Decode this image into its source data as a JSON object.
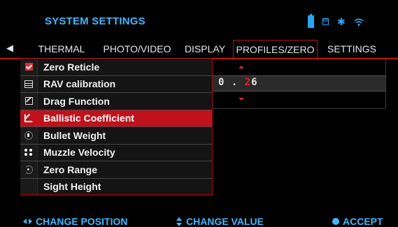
{
  "header": {
    "title": "SYSTEM SETTINGS",
    "status_icons": [
      "battery-icon",
      "sd-card-icon",
      "bluetooth-icon",
      "wifi-icon"
    ],
    "sd_label": "SD",
    "bt_glyph": "✱"
  },
  "nav": {
    "back_icon": "back-arrow-icon",
    "back_glyph": "◀",
    "tabs": [
      {
        "label": "THERMAL",
        "active": false
      },
      {
        "label": "PHOTO/VIDEO",
        "active": false
      },
      {
        "label": "DISPLAY",
        "active": false
      },
      {
        "label": "PROFILES/ZERO",
        "active": true
      },
      {
        "label": "SETTINGS",
        "active": false
      }
    ]
  },
  "menu": {
    "items": [
      {
        "label": "Zero Reticle",
        "icon": "checkbox-icon",
        "selected": false
      },
      {
        "label": "RAV calibration",
        "icon": "calculator-icon",
        "selected": false
      },
      {
        "label": "Drag Function",
        "icon": "edit-icon",
        "selected": false
      },
      {
        "label": "Ballistic Coefficient",
        "icon": "external-link-icon",
        "selected": true
      },
      {
        "label": "Bullet Weight",
        "icon": "weight-icon",
        "selected": false
      },
      {
        "label": "Muzzle Velocity",
        "icon": "dots-icon",
        "selected": false
      },
      {
        "label": "Zero Range",
        "icon": "range-icon",
        "selected": false
      },
      {
        "label": "Sight Height",
        "icon": "",
        "selected": false
      }
    ]
  },
  "value_editor": {
    "prefix": "0 . ",
    "active_digit": "2",
    "suffix": "6"
  },
  "footer": {
    "change_position": "CHANGE POSITION",
    "change_value": "CHANGE VALUE",
    "accept": "ACCEPT"
  },
  "colors": {
    "accent_blue": "#3fb8ff",
    "accent_red": "#c0121b",
    "background": "#000000"
  }
}
